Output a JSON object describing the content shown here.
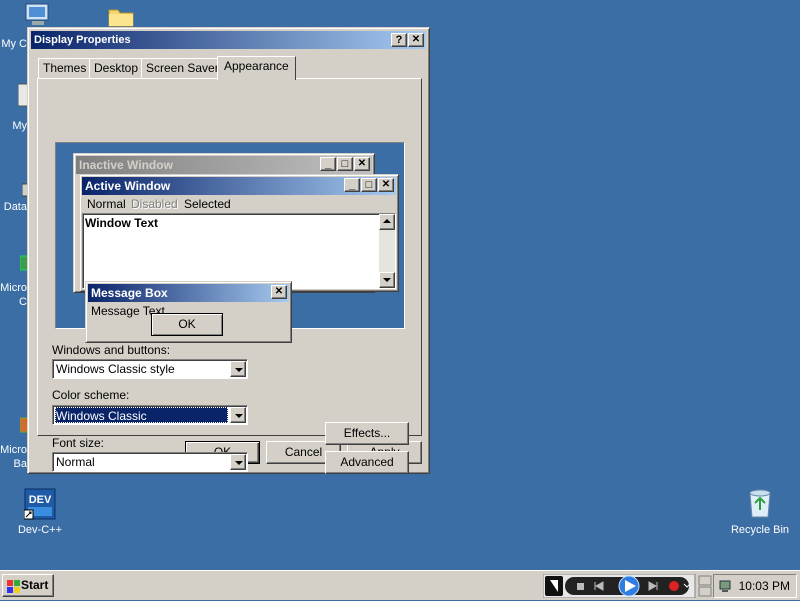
{
  "desktop": {
    "icons_left": [
      {
        "label": "My C",
        "icon": "my-computer-icon"
      },
      {
        "label": "My",
        "icon": "my-documents-icon"
      },
      {
        "label": "Data",
        "icon": "database-icon"
      },
      {
        "label": "Micro",
        "icon": "application-icon"
      },
      {
        "label": "Micro",
        "icon": "application-icon"
      }
    ],
    "folder_icon": "folder-icon",
    "devcpp": {
      "label": "Dev-C++",
      "badge": "DEV"
    },
    "recycle_bin": {
      "label": "Recycle Bin"
    }
  },
  "dialog": {
    "title": "Display Properties",
    "help_label": "?",
    "close_label": "✕",
    "tabs": [
      "Themes",
      "Desktop",
      "Screen Saver",
      "Appearance"
    ],
    "active_tab": "Appearance",
    "preview": {
      "inactive_title": "Inactive Window",
      "active_title": "Active Window",
      "menu_normal": "Normal",
      "menu_disabled": "Disabled",
      "menu_selected": "Selected",
      "window_text": "Window Text",
      "message_box_title": "Message Box",
      "message_text": "Message Text",
      "ok_label": "OK"
    },
    "windows_and_buttons_label": "Windows and buttons:",
    "windows_and_buttons_value": "Windows Classic style",
    "color_scheme_label": "Color scheme:",
    "color_scheme_value": "Windows Classic",
    "font_size_label": "Font size:",
    "font_size_value": "Normal",
    "effects_label": "Effects...",
    "advanced_label": "Advanced",
    "ok_label": "OK",
    "cancel_label": "Cancel",
    "apply_label": "Apply"
  },
  "taskbar": {
    "start_label": "Start",
    "clock": "10:03 PM"
  },
  "colors": {
    "desktop": "#3a6ea5",
    "face": "#d4d0c8",
    "title_active": "#0a246a",
    "title_active_end": "#a6caf0",
    "title_inactive": "#808080",
    "title_inactive_end": "#c0c0c0",
    "selection": "#0a246a"
  }
}
